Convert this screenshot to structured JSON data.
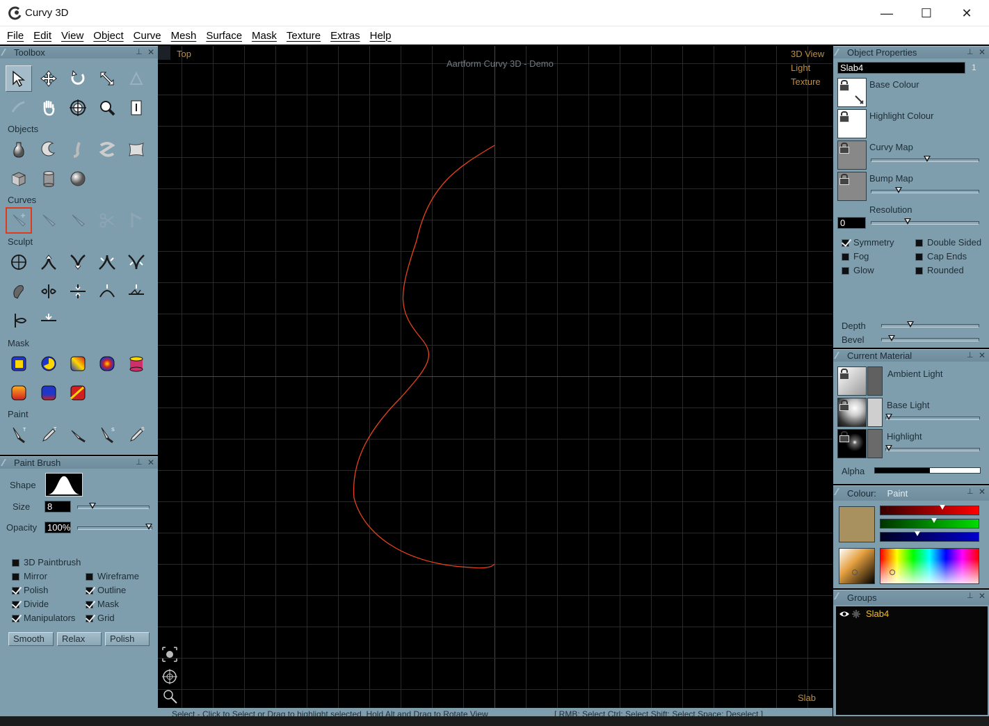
{
  "window": {
    "title": "Curvy 3D",
    "minimize": "—",
    "maximize": "☐",
    "close": "✕"
  },
  "menu": [
    "File",
    "Edit",
    "View",
    "Object",
    "Curve",
    "Mesh",
    "Surface",
    "Mask",
    "Texture",
    "Extras",
    "Help"
  ],
  "toolbox": {
    "title": "Toolbox",
    "sections": {
      "objects": "Objects",
      "curves": "Curves",
      "sculpt": "Sculpt",
      "mask": "Mask",
      "paint": "Paint"
    }
  },
  "paint_brush": {
    "title": "Paint Brush",
    "shape_label": "Shape",
    "size_label": "Size",
    "size_value": "8",
    "size_slider": 0.18,
    "opacity_label": "Opacity",
    "opacity_value": "100%",
    "opacity_slider": 1.0,
    "options": [
      {
        "label": "3D Paintbrush",
        "checked": false
      },
      {
        "label": "Mirror",
        "checked": false
      },
      {
        "label": "Wireframe",
        "checked": false
      },
      {
        "label": "Polish",
        "checked": true
      },
      {
        "label": "Outline",
        "checked": true
      },
      {
        "label": "Divide",
        "checked": true
      },
      {
        "label": "Mask",
        "checked": true
      },
      {
        "label": "Manipulators",
        "checked": true
      },
      {
        "label": "Grid",
        "checked": true
      }
    ],
    "buttons": [
      "Smooth",
      "Relax",
      "Polish"
    ]
  },
  "viewport": {
    "view_name": "Top",
    "watermark": "Aartform Curvy 3D - Demo",
    "modes": [
      "3D View",
      "Light",
      "Texture"
    ],
    "bottom_right": "Slab"
  },
  "object_properties": {
    "title": "Object Properties",
    "object_name": "Slab4",
    "object_index": "1",
    "base_colour": "Base Colour",
    "highlight_colour": "Highlight Colour",
    "curvy_map": "Curvy Map",
    "curvy_map_slider": 0.52,
    "bump_map": "Bump Map",
    "bump_map_slider": 0.24,
    "resolution_label": "Resolution",
    "resolution_value": "0",
    "resolution_slider": 0.33,
    "options": [
      {
        "label": "Symmetry",
        "checked": true
      },
      {
        "label": "Double Sided",
        "checked": false
      },
      {
        "label": "Fog",
        "checked": false
      },
      {
        "label": "Cap Ends",
        "checked": false
      },
      {
        "label": "Glow",
        "checked": false
      },
      {
        "label": "Rounded",
        "checked": false
      }
    ],
    "depth_label": "Depth",
    "depth_slider": 0.28,
    "bevel_label": "Bevel",
    "bevel_slider": 0.08
  },
  "current_material": {
    "title": "Current Material",
    "ambient_light": "Ambient Light",
    "base_light": "Base Light",
    "base_light_slider": 0.0,
    "highlight": "Highlight",
    "highlight_slider": 0.0,
    "alpha_label": "Alpha",
    "alpha_slider": 0.52
  },
  "colour": {
    "title": "Colour:",
    "mode": "Paint",
    "swatch": "#a8915f",
    "red_slider": 0.63,
    "green_slider": 0.54,
    "blue_slider": 0.36
  },
  "groups": {
    "title": "Groups",
    "items": [
      {
        "label": "Slab4"
      }
    ]
  },
  "status": {
    "left": "Select - Click to Select or Drag to highlight selected. Hold Alt and Drag to Rotate View",
    "right": "[ RMB: Select   Ctrl: Select   Shift: Select   Space: Deselect ]"
  },
  "colors": {
    "panel": "#7e9eae",
    "curve": "#e8431e",
    "accent_text": "#c28e3c",
    "group_label": "#f0c030"
  }
}
